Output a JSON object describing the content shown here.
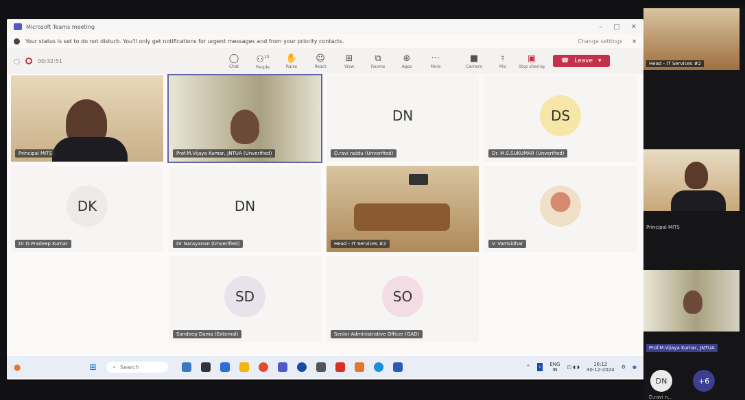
{
  "window": {
    "title": "Microsoft Teams meeting"
  },
  "notification": {
    "text": "Your status is set to do not disturb. You'll only get notifications for urgent messages and from your priority contacts.",
    "action": "Change settings"
  },
  "toolbar": {
    "timer": "00:32:51",
    "buttons": [
      {
        "label": "Chat",
        "icon": "chat-icon"
      },
      {
        "label": "People",
        "icon": "people-icon",
        "count": "10"
      },
      {
        "label": "Raise",
        "icon": "hand-icon"
      },
      {
        "label": "React",
        "icon": "react-icon"
      },
      {
        "label": "View",
        "icon": "view-icon"
      },
      {
        "label": "Rooms",
        "icon": "rooms-icon"
      },
      {
        "label": "Apps",
        "icon": "apps-icon"
      },
      {
        "label": "More",
        "icon": "more-icon"
      },
      {
        "label": "Camera",
        "icon": "camera-icon"
      },
      {
        "label": "Mic",
        "icon": "mic-icon"
      },
      {
        "label": "Stop sharing",
        "icon": "share-icon"
      }
    ],
    "leave_label": "Leave"
  },
  "participants": [
    {
      "name": "Principal MITS",
      "type": "video"
    },
    {
      "name": "Prof.M.Vijaya Kumar, JNTUA (Unverified)",
      "type": "video"
    },
    {
      "name": "D.ravi naidu (Unverified)",
      "initials": "DN",
      "type": "avatar"
    },
    {
      "name": "Dr. M.S.SUKUMAR (Unverified)",
      "initials": "DS",
      "type": "avatar"
    },
    {
      "name": "Dr D.Pradeep Kumar",
      "initials": "DK",
      "type": "avatar"
    },
    {
      "name": "Dr Narayanan (Unverified)",
      "initials": "DN",
      "type": "avatar"
    },
    {
      "name": "Head - IT Services #2",
      "type": "video"
    },
    {
      "name": "V. Vamsidhar",
      "type": "photo"
    },
    {
      "name": "Sandeep Dama (External)",
      "initials": "SD",
      "type": "avatar"
    },
    {
      "name": "Senior Administrative Officer (GAD)",
      "initials": "SO",
      "type": "avatar"
    }
  ],
  "taskbar": {
    "search_placeholder": "Search",
    "lang": "ENG",
    "lang2": "IN",
    "time": "16:12",
    "date": "30-12-2024"
  },
  "strip": {
    "tile1": "Head - IT Services #2",
    "tile2": "Principal MITS",
    "tile3": "Prof.M.Vijaya Kumar, JNTUA",
    "avatar1": "DN",
    "avatar2": "+6",
    "avatar1_name": "D.ravi n..."
  }
}
